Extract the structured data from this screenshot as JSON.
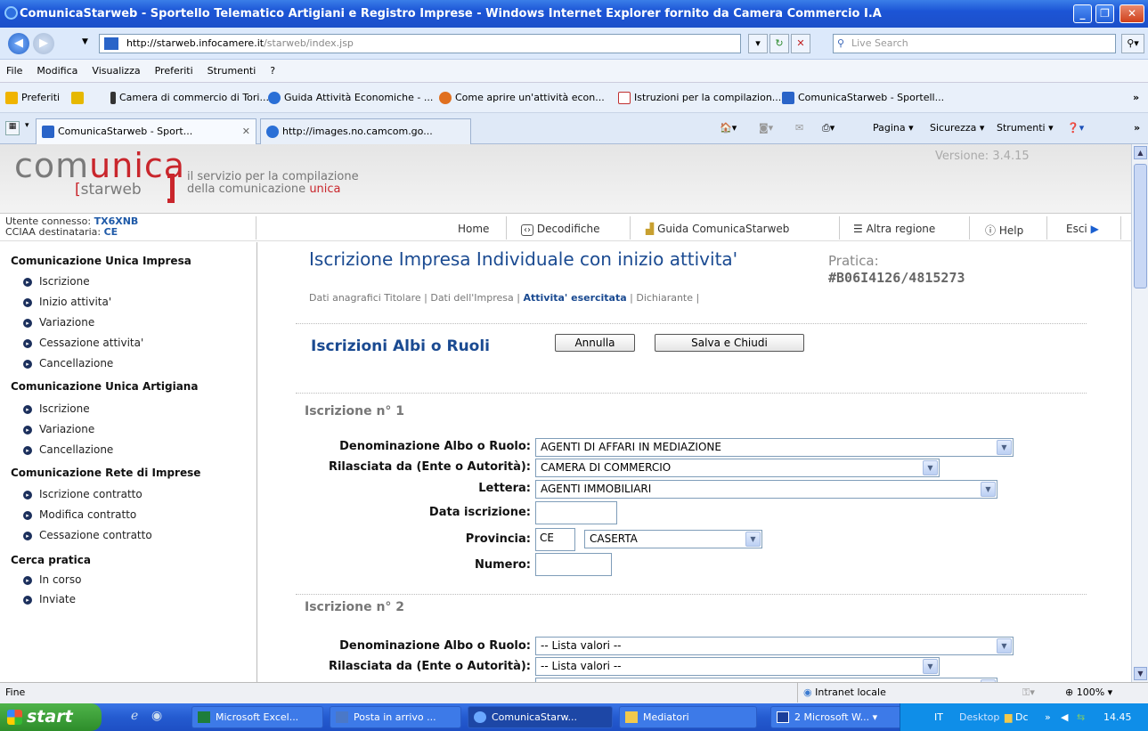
{
  "window": {
    "title": "ComunicaStarweb - Sportello Telematico Artigiani e Registro Imprese - Windows Internet Explorer fornito da Camera Commercio I.A"
  },
  "address": {
    "host": "http://starweb.infocamere.it",
    "path": "/starweb/index.jsp",
    "search_placeholder": "Live Search"
  },
  "menu": [
    "File",
    "Modifica",
    "Visualizza",
    "Preferiti",
    "Strumenti",
    "?"
  ],
  "favorites": {
    "label": "Preferiti",
    "items": [
      "Camera di commercio di Tori...",
      "Guida Attività Economiche - ...",
      "Come aprire un'attività econ...",
      "Istruzioni per la compilazion...",
      "ComunicaStarweb - Sportell..."
    ]
  },
  "tabs": [
    {
      "label": "ComunicaStarweb - Sport..."
    },
    {
      "label": "http://images.no.camcom.go..."
    }
  ],
  "commands": [
    "Pagina ▾",
    "Sicurezza ▾",
    "Strumenti ▾"
  ],
  "header": {
    "logo_main_a": "com",
    "logo_main_b": "unica",
    "logo_sub": "starweb",
    "tagline_1": "il servizio per la compilazione",
    "tagline_2a": "della comunicazione ",
    "tagline_2b": "unica",
    "version": "Versione: 3.4.15"
  },
  "user": {
    "connected_label": "Utente connesso: ",
    "connected_value": "TX6XNB",
    "cciaa_label": "CCIAA destinataria: ",
    "cciaa_value": "CE"
  },
  "nav": [
    "Home",
    "Decodifiche",
    "Guida ComunicaStarweb",
    "Altra regione",
    "Help",
    "Esci"
  ],
  "sidebar": {
    "sections": [
      {
        "title": "Comunicazione Unica Impresa",
        "items": [
          "Iscrizione",
          "Inizio attivita'",
          "Variazione",
          "Cessazione attivita'",
          "Cancellazione"
        ]
      },
      {
        "title": "Comunicazione Unica Artigiana",
        "items": [
          "Iscrizione",
          "Variazione",
          "Cancellazione"
        ]
      },
      {
        "title": "Comunicazione Rete di Imprese",
        "items": [
          "Iscrizione contratto",
          "Modifica contratto",
          "Cessazione contratto"
        ]
      },
      {
        "title": "Cerca pratica",
        "items": [
          "In corso",
          "Inviate"
        ]
      }
    ]
  },
  "main": {
    "title": "Iscrizione Impresa Individuale con inizio attivita'",
    "pratica_label": "Pratica:",
    "pratica_value": "#B06I4126/4815273",
    "steps": [
      "Dati anagrafici Titolare",
      "Dati dell'Impresa",
      "Attivita' esercitata",
      "Dichiarante"
    ],
    "section_title": "Iscrizioni Albi o Ruoli",
    "annulla": "Annulla",
    "salva": "Salva e Chiudi",
    "iscrizione1": {
      "heading": "Iscrizione n° 1",
      "denominazione_label": "Denominazione Albo o Ruolo:",
      "denominazione": "AGENTI DI AFFARI IN MEDIAZIONE",
      "rilasciata_label": "Rilasciata da (Ente o Autorità):",
      "rilasciata": "CAMERA DI COMMERCIO",
      "lettera_label": "Lettera:",
      "lettera": "AGENTI IMMOBILIARI",
      "data_label": "Data iscrizione:",
      "data": "",
      "provincia_label": "Provincia:",
      "provincia_code": "CE",
      "provincia_name": "CASERTA",
      "numero_label": "Numero:",
      "numero": ""
    },
    "iscrizione2": {
      "heading": "Iscrizione n° 2",
      "denominazione_label": "Denominazione Albo o Ruolo:",
      "denominazione": "-- Lista valori --",
      "rilasciata_label": "Rilasciata da (Ente o Autorità):",
      "rilasciata": "-- Lista valori --"
    }
  },
  "statusbar": {
    "text": "Fine",
    "zone": "Intranet locale",
    "zoom": "100%"
  },
  "taskbar": {
    "start": "start",
    "tasks": [
      "Microsoft Excel...",
      "Posta in arrivo ...",
      "ComunicaStarw...",
      "Mediatori",
      "2 Microsoft W..."
    ],
    "lang": "IT",
    "desktop": "Desktop",
    "dc": "Dc",
    "time": "14.45"
  }
}
